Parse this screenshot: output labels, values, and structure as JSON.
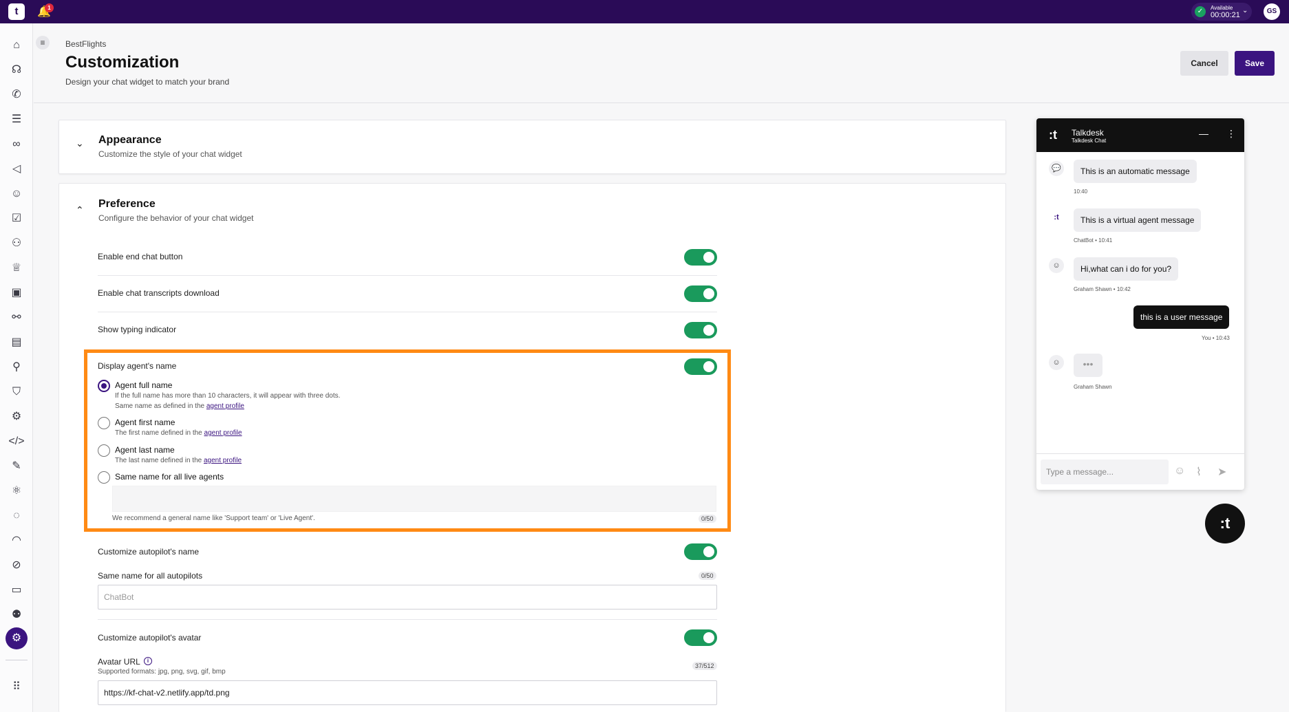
{
  "topbar": {
    "logo": "t",
    "notification_count": "1",
    "status_label": "Available",
    "status_time": "00:00:21",
    "avatar_initials": "GS"
  },
  "sidebar": {
    "icons": [
      "home-icon",
      "conversations-icon",
      "calls-icon",
      "list-icon",
      "voicemail-icon",
      "campaigns-icon",
      "team-icon",
      "tasks-icon",
      "workforce-icon",
      "trophy-icon",
      "contacts-icon",
      "routing-icon",
      "knowledge-icon",
      "flows-icon",
      "shield-icon",
      "integrations-icon",
      "code-icon",
      "edit-icon",
      "ai-icon",
      "chat-icon",
      "dashboard-icon",
      "explore-icon",
      "briefcase-icon",
      "users-icon",
      "settings-icon",
      "apps-icon"
    ]
  },
  "header": {
    "breadcrumb": "BestFlights",
    "title": "Customization",
    "subtitle": "Design your chat widget to match your brand",
    "cancel_label": "Cancel",
    "save_label": "Save"
  },
  "appearance": {
    "title": "Appearance",
    "subtitle": "Customize the style of your chat widget"
  },
  "preference": {
    "title": "Preference",
    "subtitle": "Configure the behavior of your chat widget",
    "rows": {
      "end_chat": "Enable end chat button",
      "transcripts": "Enable chat transcripts download",
      "typing": "Show typing indicator",
      "agent_name": "Display agent's name",
      "autopilot_name": "Customize autopilot's name",
      "autopilot_avatar": "Customize autopilot's avatar"
    },
    "agent_options": {
      "full": {
        "label": "Agent full name",
        "help1": "If the full name has more than 10 characters, it will appear with three dots.",
        "help2": "Same name as defined in the ",
        "link": "agent profile"
      },
      "first": {
        "label": "Agent first name",
        "help": "The first name defined in the ",
        "link": "agent profile"
      },
      "last": {
        "label": "Agent last name",
        "help": "The last name defined in the ",
        "link": "agent profile"
      },
      "same": {
        "label": "Same name for all live agents"
      }
    },
    "same_name_hint": "We recommend a general name like 'Support team' or 'Live Agent'.",
    "same_name_counter": "0/50",
    "autopilot_same_label": "Same name for all autopilots",
    "autopilot_counter": "0/50",
    "autopilot_placeholder": "ChatBot",
    "avatar_url_label": "Avatar URL",
    "avatar_url_help": "Supported formats: jpg, png, svg, gif, bmp",
    "avatar_url_counter": "37/512",
    "avatar_url_value": "https://kf-chat-v2.netlify.app/td.png"
  },
  "chat_preview": {
    "title": "Talkdesk",
    "subtitle": "Talkdesk Chat",
    "messages": [
      {
        "text": "This is an automatic message",
        "meta": "10:40"
      },
      {
        "text": "This is a virtual agent message",
        "meta": "ChatBot • 10:41"
      },
      {
        "text": "Hi,what can i do for you?",
        "meta": "Graham Shawn • 10:42"
      },
      {
        "text": "this is a user message",
        "meta": "You • 10:43"
      },
      {
        "text": "•••",
        "meta": "Graham Shawn"
      }
    ],
    "input_placeholder": "Type a message..."
  },
  "colors": {
    "topbar": "#2a0b57",
    "primary": "#3b1480",
    "toggle_on": "#1a9a5c",
    "highlight": "#ff8a14"
  }
}
